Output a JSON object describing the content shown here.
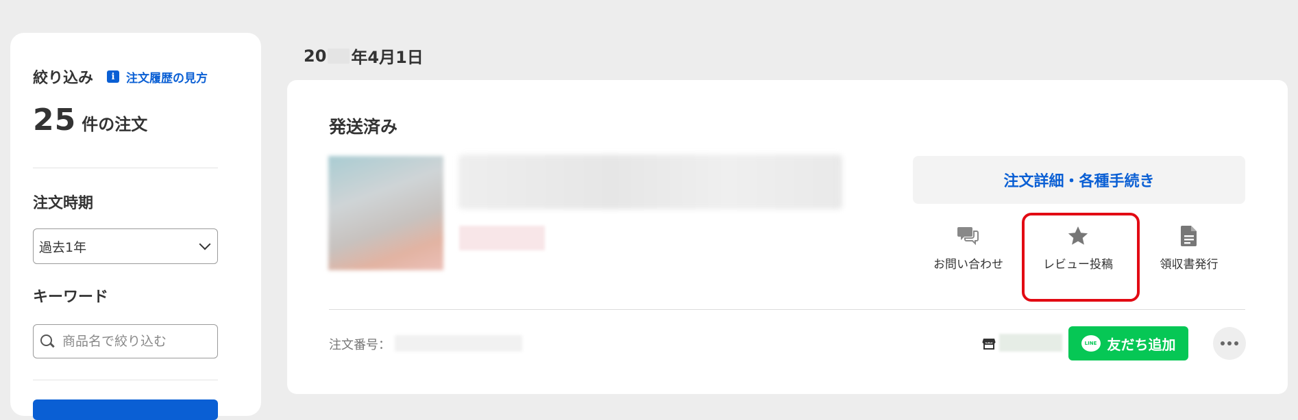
{
  "sidebar": {
    "filter_title": "絞り込み",
    "help_link": "注文履歴の見方",
    "order_count": "25",
    "order_count_unit": "件の注文",
    "period_title": "注文時期",
    "period_selected": "過去1年",
    "keyword_title": "キーワード",
    "search_placeholder": "商品名で絞り込む"
  },
  "order": {
    "date_prefix": "20",
    "date_suffix": "年4月1日",
    "status": "発送済み",
    "detail_button": "注文詳細・各種手続き",
    "actions": {
      "contact": "お問い合わせ",
      "review": "レビュー投稿",
      "receipt": "領収書発行"
    },
    "order_number_label": "注文番号：",
    "line_button": "友だち追加",
    "line_icon_text": "LINE"
  },
  "colors": {
    "accent_blue": "#0a5fd4",
    "line_green": "#06c755",
    "highlight_red": "#e20a13"
  }
}
